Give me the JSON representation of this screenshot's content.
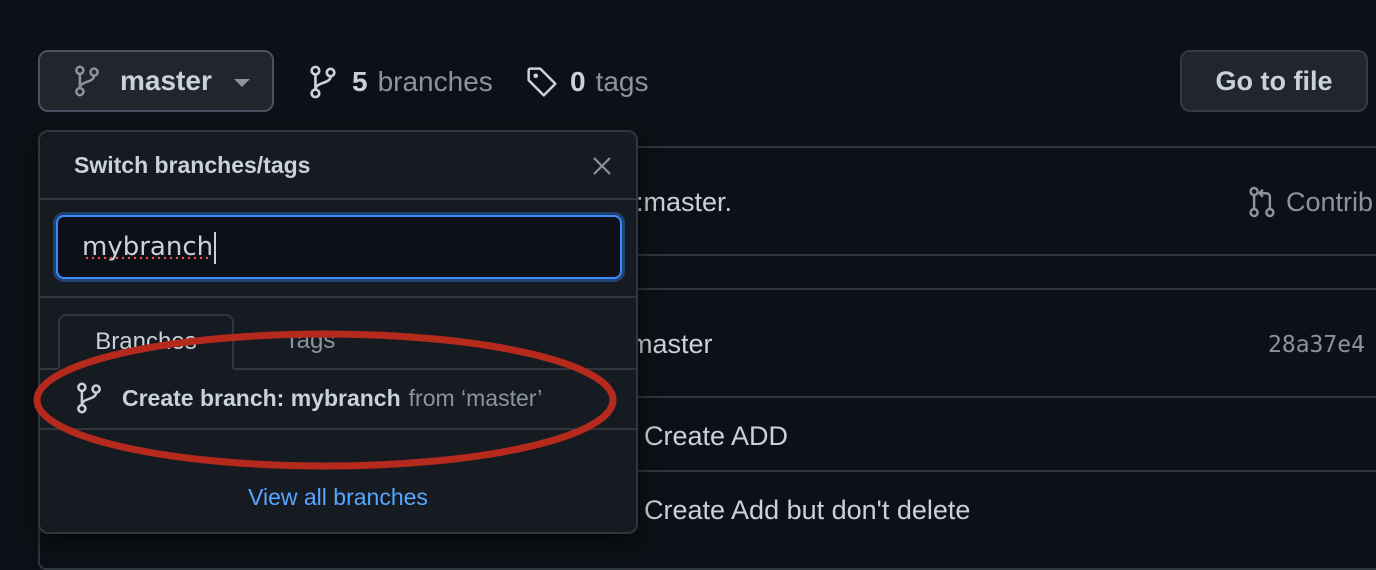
{
  "toolbar": {
    "branch_label": "master",
    "branches_count": "5",
    "branches_label": "branches",
    "tags_count": "0",
    "tags_label": "tags",
    "goto_label": "Go to file"
  },
  "background": {
    "row1_text": ":master.",
    "contrib_label": "Contrib",
    "row2_text": "master",
    "row2_hash": "28a37e4",
    "row3_text": "Create ADD",
    "row4_text": "Create Add but don't delete"
  },
  "dropdown": {
    "title": "Switch branches/tags",
    "filter_value": "mybranch",
    "tabs": [
      {
        "label": "Branches"
      },
      {
        "label": "Tags"
      }
    ],
    "create_prefix": "Create branch: mybranch",
    "create_from": "from ‘master’",
    "view_all": "View all branches"
  },
  "colors": {
    "background": "#0d1117",
    "accent_link": "#58a6ff",
    "focus_border": "#388bfd",
    "annotation": "#b52a1c"
  },
  "icons": {
    "branch": "git-branch-icon",
    "tag": "tag-icon",
    "close": "x-icon",
    "pull_request": "git-pull-request-icon"
  }
}
